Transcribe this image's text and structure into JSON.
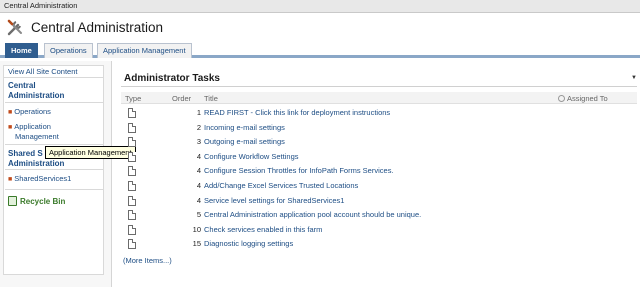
{
  "topbar": {
    "title": "Central Administration"
  },
  "site": {
    "title": "Central Administration",
    "icon": "tools-icon"
  },
  "tabs": [
    {
      "label": "Home",
      "selected": true
    },
    {
      "label": "Operations"
    },
    {
      "label": "Application Management"
    }
  ],
  "nav": {
    "view_all": "View All Site Content",
    "section1_heading_line1": "Central",
    "section1_heading_line2": "Administration",
    "links": [
      "Operations",
      "Application",
      "Management"
    ],
    "section2_heading_line1": "Shared S",
    "section2_heading_line2": "Administration",
    "shared_link": "SharedServices1",
    "recycle_bin": "Recycle Bin"
  },
  "tooltip": "Application Management",
  "panel": {
    "title": "Administrator Tasks",
    "columns": {
      "type": "Type",
      "order": "Order",
      "title": "Title",
      "assigned": "Assigned To"
    },
    "rows": [
      {
        "order": "1",
        "title": "READ FIRST - Click this link for deployment instructions"
      },
      {
        "order": "2",
        "title": "Incoming e-mail settings"
      },
      {
        "order": "3",
        "title": "Outgoing e-mail settings"
      },
      {
        "order": "4",
        "title": "Configure Workflow Settings"
      },
      {
        "order": "4",
        "title": "Configure Session Throttles for InfoPath Forms Services."
      },
      {
        "order": "4",
        "title": "Add/Change Excel Services Trusted Locations"
      },
      {
        "order": "4",
        "title": "Service level settings for SharedServices1"
      },
      {
        "order": "5",
        "title": "Central Administration application pool account should be unique."
      },
      {
        "order": "10",
        "title": "Check services enabled in this farm"
      },
      {
        "order": "15",
        "title": "Diagnostic logging settings"
      }
    ],
    "more_items": "(More Items...)"
  }
}
